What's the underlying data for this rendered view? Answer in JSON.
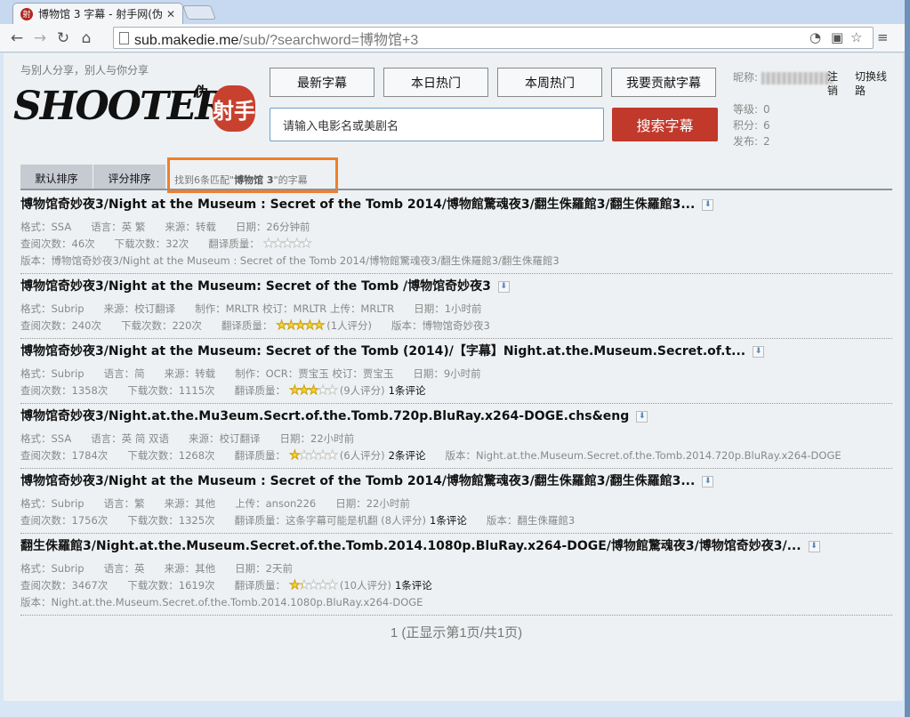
{
  "browser": {
    "tab_title": "博物馆 3 字幕 - 射手网(伪",
    "favicon_text": "射",
    "url_host": "sub.makedie.me",
    "url_path": "/sub/?searchword=博物馆+3"
  },
  "header": {
    "slogan": "与别人分享，别人与你分享",
    "logo_text": "SHOOTER",
    "logo_wei": "伪",
    "logo_seal": "射手",
    "nav": [
      "最新字幕",
      "本日热门",
      "本周热门",
      "我要贡献字幕"
    ],
    "search_placeholder": "请输入电影名或美剧名",
    "search_button": "搜索字幕"
  },
  "user": {
    "nickname_label": "昵称:",
    "logout": "注销",
    "switch_line": "切换线路",
    "level_label": "等级:",
    "level": "0",
    "points_label": "积分:",
    "points": "6",
    "posts_label": "发布:",
    "posts": "2"
  },
  "sort": {
    "default": "默认排序",
    "rating": "评分排序",
    "found_prefix": "找到6条匹配\"",
    "found_term": "博物馆 3",
    "found_suffix": "\"的字幕"
  },
  "results": [
    {
      "title": "博物馆奇妙夜3/Night at the Museum : Secret of the Tomb 2014/博物館驚魂夜3/翻生侏羅館3/翻生侏羅館3...",
      "lines": [
        [
          {
            "t": "格式：SSA"
          },
          {
            "t": "语言：英 繁"
          },
          {
            "t": "来源：转载"
          },
          {
            "t": "日期：26分钟前"
          }
        ],
        [
          {
            "t": "查阅次数：46次"
          },
          {
            "t": "下载次数：32次"
          },
          {
            "t": "翻译质量：",
            "tight": true
          },
          {
            "stars": 0
          }
        ],
        [
          {
            "t": "版本：博物馆奇妙夜3/Night at the Museum : Secret of the Tomb 2014/博物館驚魂夜3/翻生侏羅館3/翻生侏羅館3"
          }
        ]
      ]
    },
    {
      "title": "博物馆奇妙夜3/Night at the Museum: Secret of the Tomb /博物馆奇妙夜3",
      "lines": [
        [
          {
            "t": "格式：Subrip"
          },
          {
            "t": "来源：校订翻译"
          },
          {
            "t": "制作：MRLTR 校订：MRLTR 上传：MRLTR"
          },
          {
            "t": "日期：1小时前"
          }
        ],
        [
          {
            "t": "查阅次数：240次"
          },
          {
            "t": "下载次数：220次"
          },
          {
            "t": "翻译质量：",
            "tight": true
          },
          {
            "stars": 5
          },
          {
            "t": "(1人评分)"
          },
          {
            "t": "版本：博物馆奇妙夜3"
          }
        ]
      ]
    },
    {
      "title": "博物馆奇妙夜3/Night at the Museum: Secret of the Tomb (2014)/【字幕】Night.at.the.Museum.Secret.of.t...",
      "lines": [
        [
          {
            "t": "格式：Subrip"
          },
          {
            "t": "语言：简"
          },
          {
            "t": "来源：转载"
          },
          {
            "t": "制作：OCR：贾宝玉 校订：贾宝玉"
          },
          {
            "t": "日期：9小时前"
          }
        ],
        [
          {
            "t": "查阅次数：1358次"
          },
          {
            "t": "下载次数：1115次"
          },
          {
            "t": "翻译质量：",
            "tight": true
          },
          {
            "stars": 3
          },
          {
            "t": "(9人评分)",
            "tight": true
          },
          {
            "t": "1条评论",
            "dark": true
          }
        ]
      ]
    },
    {
      "title": "博物馆奇妙夜3/Night.at.the.Mu3eum.Secrt.of.the.Tomb.720p.BluRay.x264-DOGE.chs&eng",
      "lines": [
        [
          {
            "t": "格式：SSA"
          },
          {
            "t": "语言：英 简 双语"
          },
          {
            "t": "来源：校订翻译"
          },
          {
            "t": "日期：22小时前"
          }
        ],
        [
          {
            "t": "查阅次数：1784次"
          },
          {
            "t": "下载次数：1268次"
          },
          {
            "t": "翻译质量：",
            "tight": true
          },
          {
            "stars": 1
          },
          {
            "t": "(6人评分)",
            "tight": true
          },
          {
            "t": "2条评论",
            "dark": true
          },
          {
            "t": "版本：Night.at.the.Museum.Secret.of.the.Tomb.2014.720p.BluRay.x264-DOGE"
          }
        ]
      ]
    },
    {
      "title": "博物馆奇妙夜3/Night at the Museum : Secret of the Tomb 2014/博物館驚魂夜3/翻生侏羅館3/翻生侏羅館3...",
      "lines": [
        [
          {
            "t": "格式：Subrip"
          },
          {
            "t": "语言：繁"
          },
          {
            "t": "来源：其他"
          },
          {
            "t": "上传：anson226"
          },
          {
            "t": "日期：22小时前"
          }
        ],
        [
          {
            "t": "查阅次数：1756次"
          },
          {
            "t": "下载次数：1325次"
          },
          {
            "t": "翻译质量：这条字幕可能是机翻 (8人评分)",
            "tight": true
          },
          {
            "t": "1条评论",
            "dark": true
          },
          {
            "t": "版本：翻生侏羅館3"
          }
        ]
      ]
    },
    {
      "title": "翻生侏羅館3/Night.at.the.Museum.Secret.of.the.Tomb.2014.1080p.BluRay.x264-DOGE/博物館驚魂夜3/博物馆奇妙夜3/...",
      "lines": [
        [
          {
            "t": "格式：Subrip"
          },
          {
            "t": "语言：英"
          },
          {
            "t": "来源：其他"
          },
          {
            "t": "日期：2天前"
          }
        ],
        [
          {
            "t": "查阅次数：3467次"
          },
          {
            "t": "下载次数：1619次"
          },
          {
            "t": "翻译质量：",
            "tight": true
          },
          {
            "stars": 1.5
          },
          {
            "t": "(10人评分)",
            "tight": true
          },
          {
            "t": "1条评论",
            "dark": true
          }
        ],
        [
          {
            "t": "版本：Night.at.the.Museum.Secret.of.the.Tomb.2014.1080p.BluRay.x264-DOGE"
          }
        ]
      ]
    }
  ],
  "pager": "1 (正显示第1页/共1页)",
  "colors": {
    "accent": "#c0392b",
    "highlight": "#f07f2b",
    "star": "#f6d23a"
  }
}
